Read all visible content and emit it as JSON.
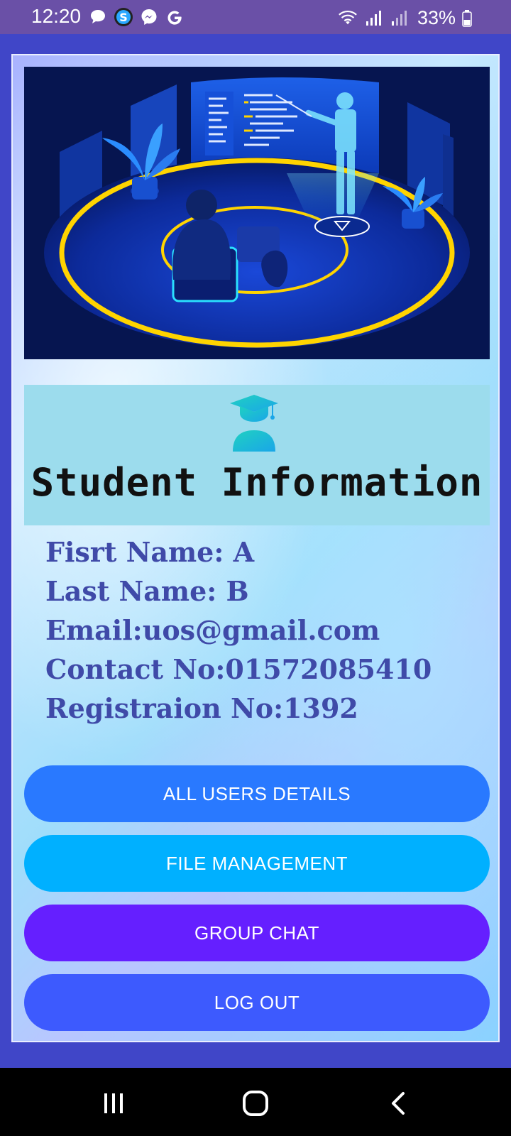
{
  "status_bar": {
    "time": "12:20",
    "battery": "33%",
    "left_icons": [
      "chat-bubble-icon",
      "app-s-icon",
      "messenger-icon",
      "google-icon"
    ],
    "right_icons": [
      "wifi-icon",
      "signal-icon",
      "signal-icon",
      "battery-icon"
    ]
  },
  "hero": {
    "icon": "online-classroom-illustration"
  },
  "banner": {
    "icon": "graduate-student-icon",
    "title": "Student Information"
  },
  "student": {
    "first_name": "Fisrt Name: A",
    "last_name": "Last Name: B",
    "email": "Email:uos@gmail.com",
    "contact": "Contact No:01572085410",
    "registration": "Registraion No:1392"
  },
  "buttons": {
    "all_users": "ALL USERS DETAILS",
    "file_management": "FILE MANAGEMENT",
    "group_chat": "GROUP CHAT",
    "log_out": "LOG OUT"
  },
  "nav_bar": {
    "icons": [
      "recents-icon",
      "home-icon",
      "back-icon"
    ]
  },
  "colors": {
    "status_bar": "#6a50a7",
    "frame_border": "#4046c8",
    "info_text": "#3f4aa8",
    "btn_all_users": "#2979ff",
    "btn_file_management": "#00b0ff",
    "btn_group_chat": "#651fff",
    "btn_log_out": "#3d5afe"
  }
}
